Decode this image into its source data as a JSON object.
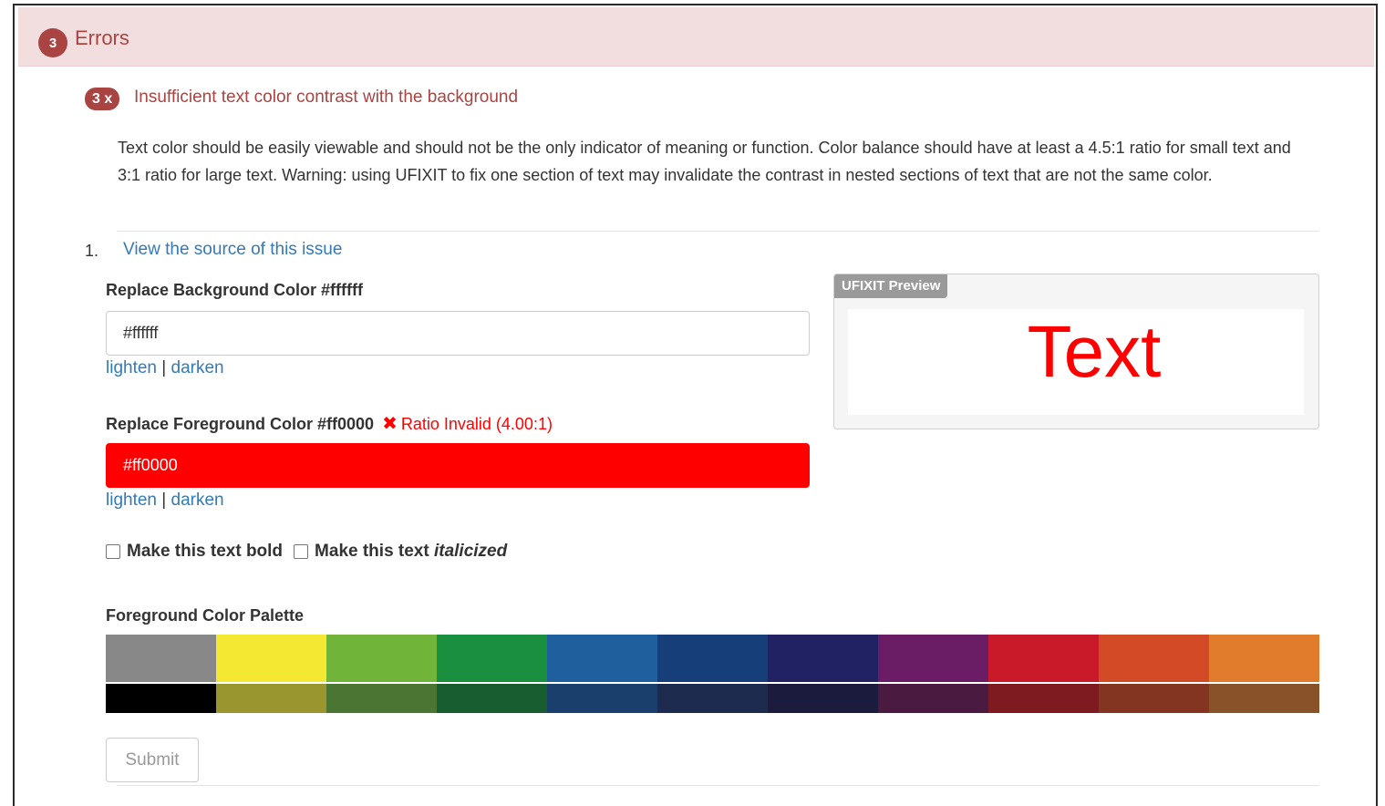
{
  "header": {
    "count": "3",
    "title": "Errors"
  },
  "issue": {
    "badge": "3 x",
    "title": "Insufficient text color contrast with the background",
    "description": "Text color should be easily viewable and should not be the only indicator of meaning or function. Color balance should have at least a 4.5:1 ratio for small text and 3:1 ratio for large text. Warning: using UFIXIT to fix one section of text may invalidate the contrast in nested sections of text that are not the same color."
  },
  "item": {
    "number": "1.",
    "source_link": "View the source of this issue"
  },
  "background": {
    "label": "Replace Background Color #ffffff",
    "value": "#ffffff",
    "lighten": "lighten",
    "separator": "|",
    "darken": "darken"
  },
  "foreground": {
    "label": "Replace Foreground Color #ff0000",
    "invalid_icon": "✖",
    "invalid_text": "Ratio Invalid (4.00:1)",
    "value": "#ff0000",
    "lighten": "lighten",
    "separator": "|",
    "darken": "darken"
  },
  "preview": {
    "tag": "UFIXIT Preview",
    "text": "Text"
  },
  "options": {
    "bold_prefix": "Make this text ",
    "bold_word": "bold",
    "italic_prefix": "Make this text ",
    "italic_word": "italicized"
  },
  "palette": {
    "label": "Foreground Color Palette",
    "top_row": [
      "#888888",
      "#f4e832",
      "#71b43a",
      "#1a8f3f",
      "#205f9e",
      "#163e78",
      "#212264",
      "#6a1c65",
      "#c91a29",
      "#d34a27",
      "#e07c2c"
    ],
    "bottom_row": [
      "#000000",
      "#99952f",
      "#4a7533",
      "#175d30",
      "#1b3f6c",
      "#1d2b4e",
      "#1b1b3e",
      "#4a1a41",
      "#7e1b20",
      "#843521",
      "#8a5228"
    ]
  },
  "submit_label": "Submit",
  "colors": {
    "error_bg": "#f2dede",
    "error_text": "#a94442",
    "link": "#337ab7",
    "invalid": "#ff0000"
  }
}
